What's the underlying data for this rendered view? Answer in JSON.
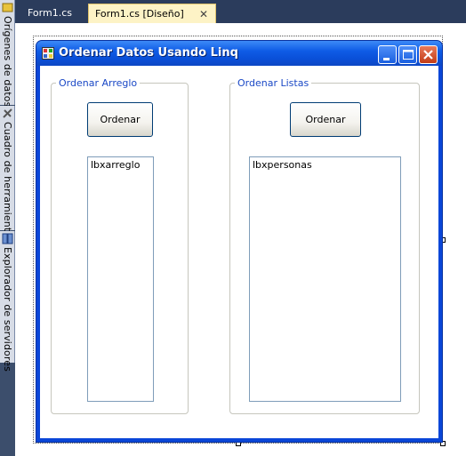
{
  "ide": {
    "tabs": [
      {
        "label": "Form1.cs",
        "active": false
      },
      {
        "label": "Form1.cs [Diseño]",
        "active": true
      }
    ],
    "side_panels": [
      {
        "label": "Orígenes de datos",
        "icon": "data-sources-icon"
      },
      {
        "label": "Cuadro de herramientas",
        "icon": "toolbox-icon"
      },
      {
        "label": "Explorador de servidores",
        "icon": "server-explorer-icon"
      }
    ],
    "colors": {
      "tab_strip": "#2b3c5c",
      "side_strip": "#3c4e6c",
      "active_tab": "#fdf3c6"
    }
  },
  "form": {
    "title": "Ordenar Datos Usando Linq",
    "title_icon": "form-icon",
    "window_buttons": [
      "minimize-icon",
      "maximize-icon",
      "close-icon"
    ],
    "groups": [
      {
        "legend": "Ordenar Arreglo",
        "button_label": "Ordenar",
        "listbox_text": "lbxarreglo"
      },
      {
        "legend": "Ordenar Listas",
        "button_label": "Ordenar",
        "listbox_text": "lbxpersonas"
      }
    ],
    "colors": {
      "titlebar": "#0a50d9",
      "legend_text": "#1a48c6",
      "close_button": "#c23c16"
    }
  }
}
